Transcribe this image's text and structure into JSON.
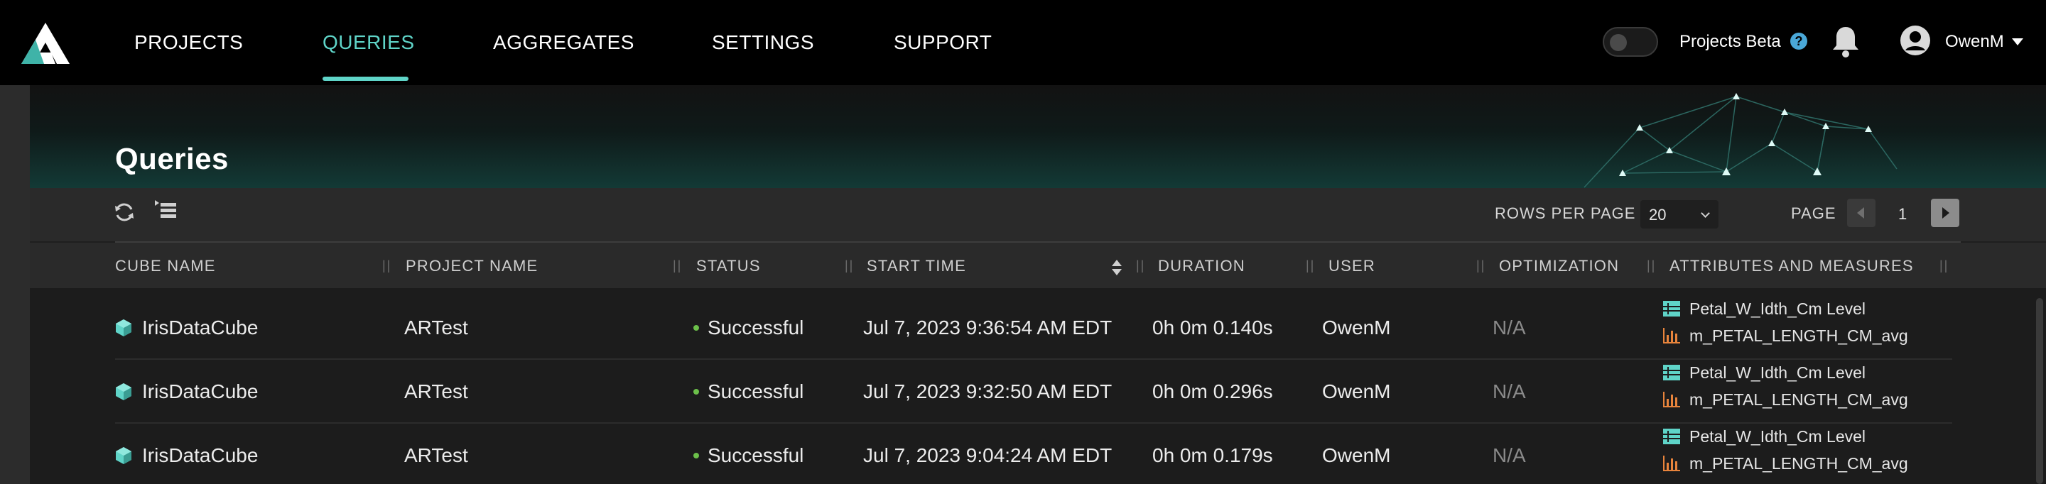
{
  "nav": {
    "items": [
      {
        "label": "PROJECTS",
        "active": false
      },
      {
        "label": "QUERIES",
        "active": true
      },
      {
        "label": "AGGREGATES",
        "active": false
      },
      {
        "label": "SETTINGS",
        "active": false
      },
      {
        "label": "SUPPORT",
        "active": false
      }
    ],
    "beta_toggle": {
      "label": "Projects Beta",
      "on": false
    },
    "help_glyph": "?",
    "user": {
      "name": "OwenM"
    },
    "accent_color": "#5fd4c8"
  },
  "page": {
    "title": "Queries"
  },
  "toolbar": {
    "icons": [
      "refresh-icon",
      "column-list-icon"
    ],
    "rows_per_page_label": "ROWS PER PAGE",
    "rows_per_page_value": "20",
    "page_label": "PAGE",
    "page_number": "1"
  },
  "table": {
    "columns": [
      "CUBE NAME",
      "PROJECT NAME",
      "STATUS",
      "START TIME",
      "DURATION",
      "USER",
      "OPTIMIZATION",
      "ATTRIBUTES AND MEASURES"
    ],
    "sorted_column": "START TIME",
    "column_separator": "||",
    "rows": [
      {
        "cube": "IrisDataCube",
        "project": "ARTest",
        "status": "Successful",
        "start_time": "Jul 7, 2023 9:36:54 AM EDT",
        "duration": "0h 0m 0.140s",
        "user": "OwenM",
        "optimization": "N/A",
        "attribute": "Petal_W_Idth_Cm Level",
        "measure": "m_PETAL_LENGTH_CM_avg"
      },
      {
        "cube": "IrisDataCube",
        "project": "ARTest",
        "status": "Successful",
        "start_time": "Jul 7, 2023 9:32:50 AM EDT",
        "duration": "0h 0m 0.296s",
        "user": "OwenM",
        "optimization": "N/A",
        "attribute": "Petal_W_Idth_Cm Level",
        "measure": "m_PETAL_LENGTH_CM_avg"
      },
      {
        "cube": "IrisDataCube",
        "project": "ARTest",
        "status": "Successful",
        "start_time": "Jul 7, 2023 9:04:24 AM EDT",
        "duration": "0h 0m 0.179s",
        "user": "OwenM",
        "optimization": "N/A",
        "attribute": "Petal_W_Idth_Cm Level",
        "measure": "m_PETAL_LENGTH_CM_avg"
      }
    ],
    "status_color": "#6cc04a",
    "cube_icon": "cube-icon",
    "attribute_icon": "table-icon",
    "measure_icon": "bar-chart-icon",
    "attribute_icon_color": "#5fd4c8",
    "measure_icon_color": "#e8843c"
  }
}
